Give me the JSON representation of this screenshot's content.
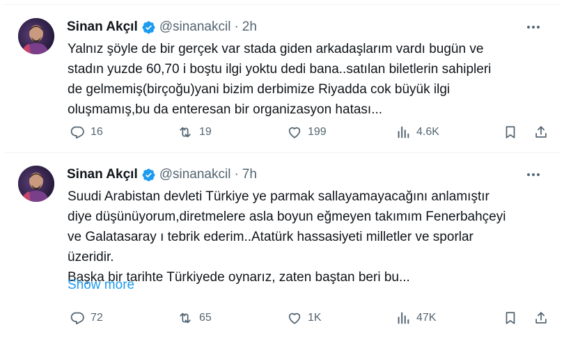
{
  "theme": {
    "accent": "#1d9bf0",
    "text": "#0f1419",
    "muted": "#536471",
    "divider": "#eff3f4"
  },
  "icons": {
    "verified": "verified-badge-icon",
    "more": "more-icon",
    "reply": "reply-icon",
    "retweet": "retweet-icon",
    "like": "like-icon",
    "views": "views-icon",
    "bookmark": "bookmark-icon",
    "share": "share-icon"
  },
  "tweets": [
    {
      "author": {
        "name": "Sinan Akçıl",
        "handle": "@sinanakcil"
      },
      "dot": "·",
      "time": "2h",
      "lines": [
        "Yalnız şöyle de bir gerçek var stada giden arkadaşlarım vardı bugün ve",
        "stadın yuzde 60,70 i boştu ilgi yoktu dedi bana..satılan biletlerin sahipleri",
        "de gelmemiş(birçoğu)yani bizim derbimize Riyadda cok büyük ilgi",
        "oluşmamış,bu da enteresan bir organizasyon hatası..."
      ],
      "stats": {
        "replies": "16",
        "retweets": "19",
        "likes": "199",
        "views": "4.6K"
      }
    },
    {
      "author": {
        "name": "Sinan Akçıl",
        "handle": "@sinanakcil"
      },
      "dot": "·",
      "time": "7h",
      "lines": [
        "Suudi Arabistan devleti Türkiye ye parmak sallayamayacağını anlamıştır",
        "diye düşünüyorum,diretmelere asla boyun eğmeyen takımım Fenerbahçeyi",
        "ve Galatasaray ı tebrik ederim..Atatürk hassasiyeti milletler ve sporlar",
        "üzeridir.",
        "Başka bir tarihte Türkiyede oynarız, zaten baştan beri bu..."
      ],
      "show_more": "Show more",
      "stats": {
        "replies": "72",
        "retweets": "65",
        "likes": "1K",
        "views": "47K"
      }
    }
  ]
}
